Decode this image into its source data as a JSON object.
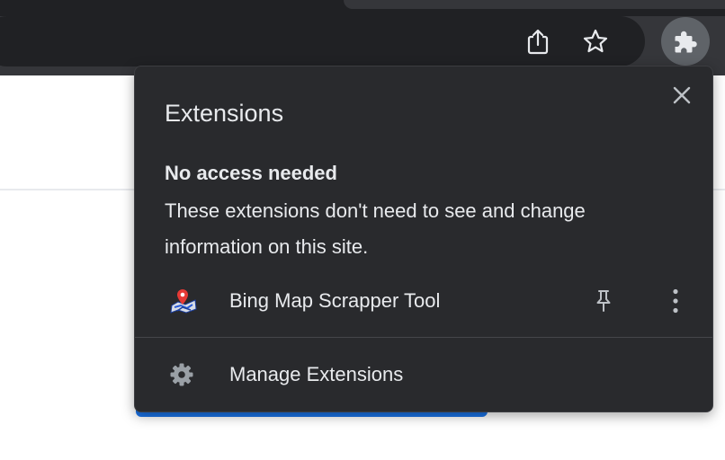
{
  "toolbar": {
    "share_icon": "share-icon",
    "bookmark_icon": "star-icon",
    "extensions_icon": "puzzle-icon"
  },
  "extensions_popup": {
    "title": "Extensions",
    "close_icon": "close-icon",
    "section_heading": "No access needed",
    "section_description": "These extensions don't need to see and change information on this site.",
    "extensions": [
      {
        "name": "Bing Map Scrapper Tool",
        "icon": "map-pin-icon",
        "pin_icon": "pin-icon",
        "menu_icon": "more-vert-icon"
      }
    ],
    "manage_label": "Manage Extensions",
    "manage_icon": "gear-icon"
  },
  "colors": {
    "popup_bg": "#292a2d",
    "toolbar_bg": "#35363a",
    "omnibox_bg": "#202124",
    "text": "#e8eaed",
    "icon_gray": "#9aa0a6",
    "page_accent": "#1a73e8"
  }
}
